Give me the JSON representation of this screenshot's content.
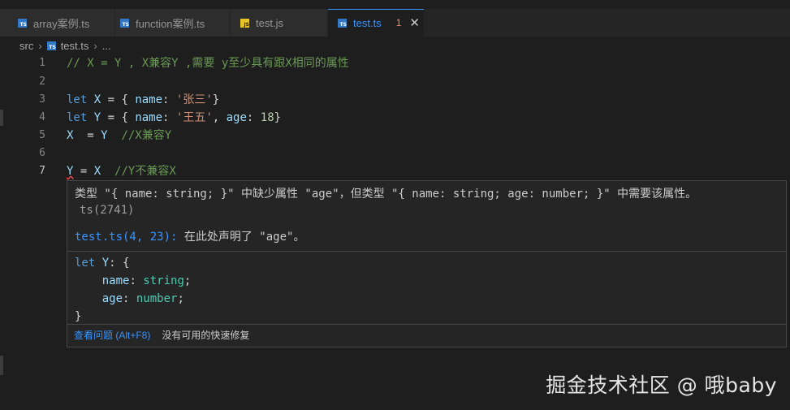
{
  "tabs": [
    {
      "label": "array案例.ts",
      "icon": "ts"
    },
    {
      "label": "function案例.ts",
      "icon": "ts"
    },
    {
      "label": "test.js",
      "icon": "js"
    },
    {
      "label": "test.ts",
      "icon": "ts",
      "badge": "1",
      "close": "✕"
    }
  ],
  "breadcrumb": {
    "folder": "src",
    "file": "test.ts",
    "more": "..."
  },
  "lines": [
    "1",
    "2",
    "3",
    "4",
    "5",
    "6",
    "7"
  ],
  "code": {
    "l1": "// X = Y , X兼容Y ,需要 y至少具有跟X相同的属性",
    "l3": {
      "kw": "let",
      "v": "X",
      "p1": " = { ",
      "k": "name",
      "p2": ": ",
      "s": "'张三'",
      "p3": "}"
    },
    "l4": {
      "kw": "let",
      "v": "Y",
      "p1": " = { ",
      "k": "name",
      "p2": ": ",
      "s": "'王五'",
      "p3": ", ",
      "k2": "age",
      "p4": ": ",
      "n": "18",
      "p5": "}"
    },
    "l5": {
      "a": "X",
      "p": "  = ",
      "b": "Y",
      "cm": "  //X兼容Y"
    },
    "l7": {
      "a": "Y",
      "p": " = ",
      "b": "X",
      "cm": "  //Y不兼容X"
    }
  },
  "hover": {
    "message": "类型 \"{ name: string; }\" 中缺少属性 \"age\"，但类型 \"{ name: string; age: number; }\" 中需要该属性。",
    "code": "ts(2741)",
    "related_link": "test.ts(4, 23):",
    "related_text": " 在此处声明了 \"age\"。",
    "snippet": {
      "kw": "let",
      "v": "Y",
      "p": ": {",
      "f1": "name",
      "t1": "string",
      "f2": "age",
      "t2": "number",
      "close": "}"
    },
    "action_view": "查看问题 (Alt+F8)",
    "action_fix": "没有可用的快速修复"
  },
  "watermark": "掘金技术社区 @ 哦baby"
}
